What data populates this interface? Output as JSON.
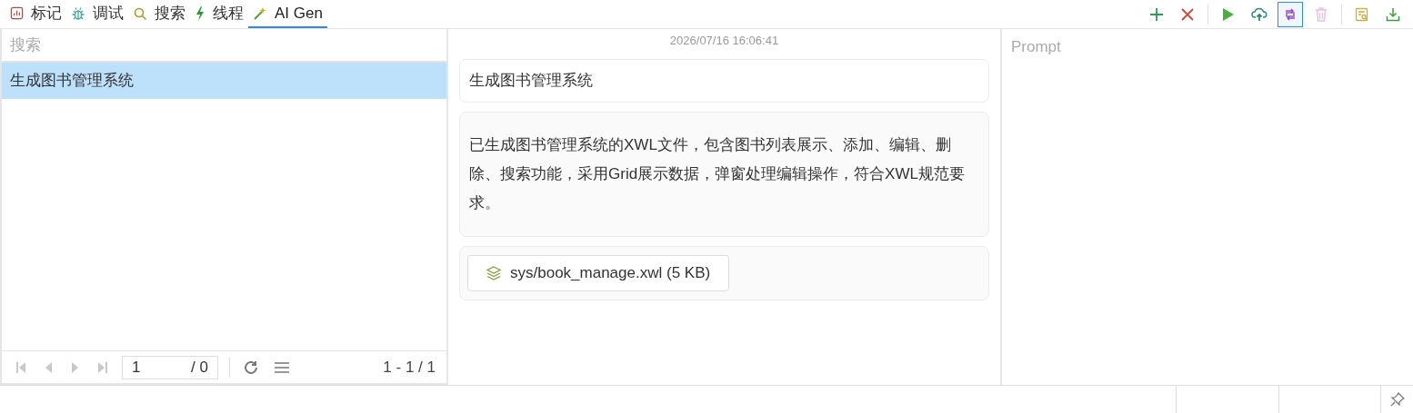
{
  "tabs": [
    {
      "kind": "chart",
      "label": "标记",
      "selected": false
    },
    {
      "kind": "bug",
      "label": "调试",
      "selected": false
    },
    {
      "kind": "search",
      "label": "搜索",
      "selected": false
    },
    {
      "kind": "bolt",
      "label": "线程",
      "selected": false
    },
    {
      "kind": "wand",
      "label": "AI Gen",
      "selected": true
    }
  ],
  "toolbar": [
    {
      "kind": "add",
      "pressed": false,
      "disabled": false
    },
    {
      "kind": "delete",
      "pressed": false,
      "disabled": false
    },
    {
      "kind": "sep"
    },
    {
      "kind": "run",
      "pressed": false,
      "disabled": false
    },
    {
      "kind": "upload",
      "pressed": false,
      "disabled": false
    },
    {
      "kind": "swap",
      "pressed": true,
      "disabled": false
    },
    {
      "kind": "trash",
      "pressed": false,
      "disabled": true
    },
    {
      "kind": "sep"
    },
    {
      "kind": "find",
      "pressed": false,
      "disabled": false
    },
    {
      "kind": "download",
      "pressed": false,
      "disabled": false
    }
  ],
  "history": {
    "search_placeholder": "搜索",
    "items": [
      {
        "label": "生成图书管理系统",
        "selected": true
      }
    ],
    "pager": {
      "buttons": [
        {
          "kind": "first",
          "disabled": true
        },
        {
          "kind": "prev",
          "disabled": true
        },
        {
          "kind": "next",
          "disabled": true
        },
        {
          "kind": "last",
          "disabled": true
        }
      ],
      "page": "1",
      "total": "/ 0",
      "range": "1 - 1 / 1"
    }
  },
  "chat": {
    "timestamp": "2026/07/16 16:06:41",
    "prompt": "生成图书管理系统",
    "reply": "已生成图书管理系统的XWL文件，包含图书列表展示、添加、编辑、删除、搜索功能，采用Grid展示数据，弹窗处理编辑操作，符合XWL规范要求。",
    "file": "sys/book_manage.xwl (5 KB)"
  },
  "prompt_field": {
    "placeholder": "Prompt"
  }
}
